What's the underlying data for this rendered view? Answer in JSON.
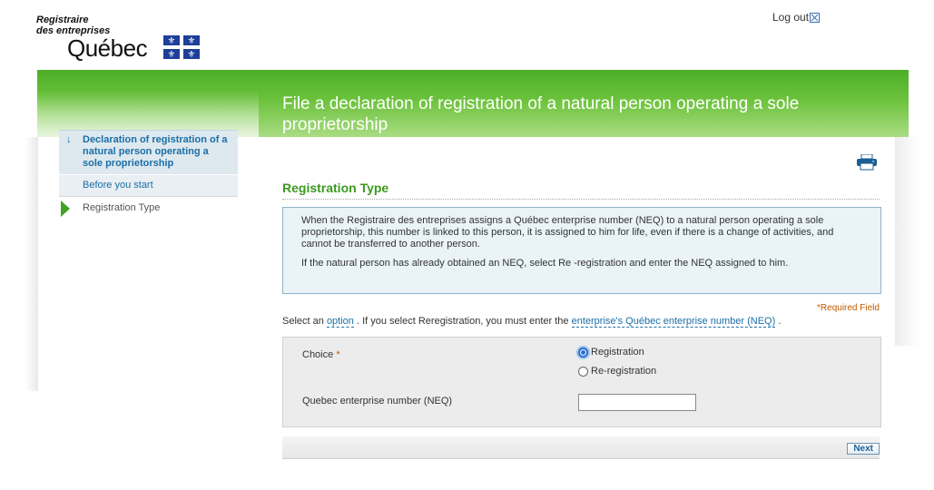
{
  "header": {
    "org_line1": "Registraire",
    "org_line2": "des entreprises",
    "org_name": "Québec",
    "logout_label": "Log out"
  },
  "page": {
    "title": "File a declaration of registration of a natural person operating a sole proprietorship"
  },
  "nav": {
    "current": "Declaration of registration of a natural person operating a sole proprietorship",
    "sub_item": "Before you start",
    "step": "Registration Type"
  },
  "section": {
    "title": "Registration Type",
    "info_p1": "When the Registraire des entreprises assigns a Québec enterprise number (NEQ) to a natural person operating a sole proprietorship, this number is linked to this person, it is assigned to him for life, even if there is a change of activities, and cannot be transferred to another person.",
    "info_p2": "If the natural person has already obtained an NEQ, select Re -registration and enter the NEQ assigned to him.",
    "required_label": "Required Field",
    "instr_prefix": "Select an",
    "instr_link1": "option",
    "instr_middle": ". If you select Reregistration, you must enter the",
    "instr_link2": "enterprise's Québec enterprise number (NEQ)",
    "instr_suffix": "."
  },
  "form": {
    "choice_label": "Choice",
    "option1": "Registration",
    "option2": "Re-registration",
    "selected": "Registration",
    "neq_label": "Quebec enterprise number (NEQ)",
    "neq_value": ""
  },
  "actions": {
    "next_label": "Next"
  },
  "colors": {
    "brand_green": "#4dae28",
    "link_blue": "#1b6fa6",
    "flag_blue": "#1d3f99",
    "required_orange": "#c05a00"
  }
}
